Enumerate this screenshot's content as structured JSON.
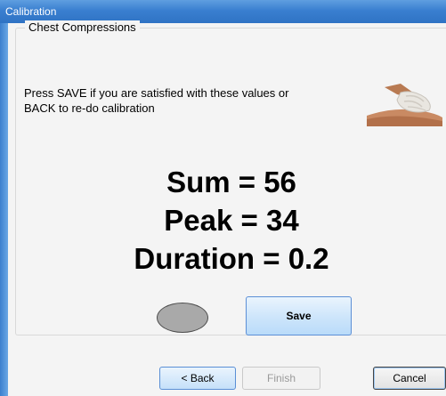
{
  "window": {
    "title": "Calibration"
  },
  "group": {
    "title": "Chest Compressions"
  },
  "message": {
    "line1": "Press SAVE if you are satisfied with these values or",
    "line2": "BACK to re-do calibration"
  },
  "results": {
    "sum": "Sum = 56",
    "peak": "Peak = 34",
    "duration": "Duration = 0.2"
  },
  "buttons": {
    "save": "Save",
    "back": "< Back",
    "finish": "Finish",
    "cancel": "Cancel"
  },
  "icons": {
    "hands_image": "chest-compression-hands-icon",
    "status_indicator": "status-oval-indicator"
  },
  "colors": {
    "titlebar": "#3a7fd0",
    "save_button": "#cfe6fb",
    "indicator": "#a9a9a9"
  }
}
